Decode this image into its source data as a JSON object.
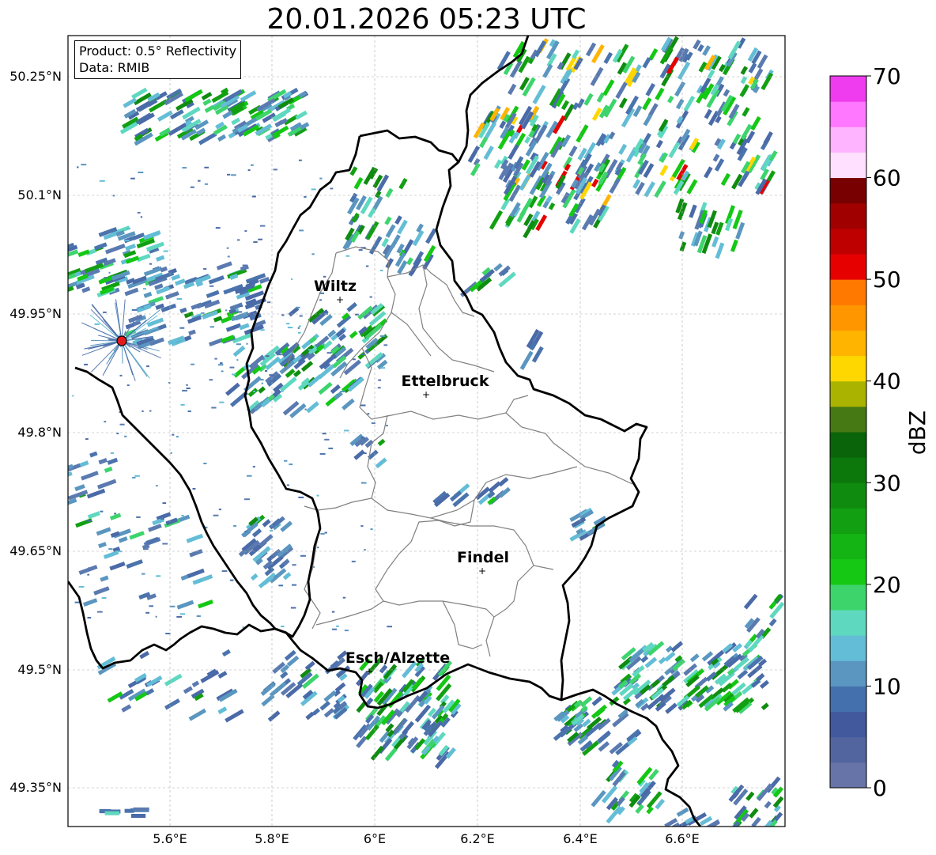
{
  "title": "20.01.2026 05:23 UTC",
  "info": {
    "product": "Product: 0.5° Reflectivity",
    "data": "Data: RMIB"
  },
  "axes": {
    "lat_labels": [
      "50.25°N",
      "50.1°N",
      "49.95°N",
      "49.8°N",
      "49.65°N",
      "49.5°N",
      "49.35°N"
    ],
    "lon_labels": [
      "5.6°E",
      "5.8°E",
      "6°E",
      "6.2°E",
      "6.4°E",
      "6.6°E"
    ]
  },
  "cities": [
    {
      "name": "Wiltz",
      "lon": 5.934,
      "lat": 49.966
    },
    {
      "name": "Ettelbruck",
      "lon": 6.1,
      "lat": 49.847
    },
    {
      "name": "Findel",
      "lon": 6.211,
      "lat": 49.625
    },
    {
      "name": "Esch/Alzette",
      "lon": 5.99,
      "lat": 49.5
    }
  ],
  "radar_site": {
    "lon": 5.505,
    "lat": 49.914,
    "color": "#e31a1c"
  },
  "colorbar": {
    "label": "dBZ",
    "min": 0,
    "max": 70,
    "tick_labels": [
      "0",
      "10",
      "20",
      "30",
      "40",
      "50",
      "60",
      "70"
    ],
    "colors": [
      "#6674a8",
      "#52659e",
      "#42599e",
      "#4471ad",
      "#5a96c0",
      "#64bdd6",
      "#5fd8c0",
      "#3dd46c",
      "#14c814",
      "#14b414",
      "#12a012",
      "#0f8c0f",
      "#0c780c",
      "#0a640a",
      "#467814",
      "#aab400",
      "#ffd700",
      "#ffb400",
      "#ff9600",
      "#ff7800",
      "#e60000",
      "#be0000",
      "#a00000",
      "#780000",
      "#ffe0ff",
      "#ffb4ff",
      "#ff78ff",
      "#ee3cee"
    ]
  }
}
